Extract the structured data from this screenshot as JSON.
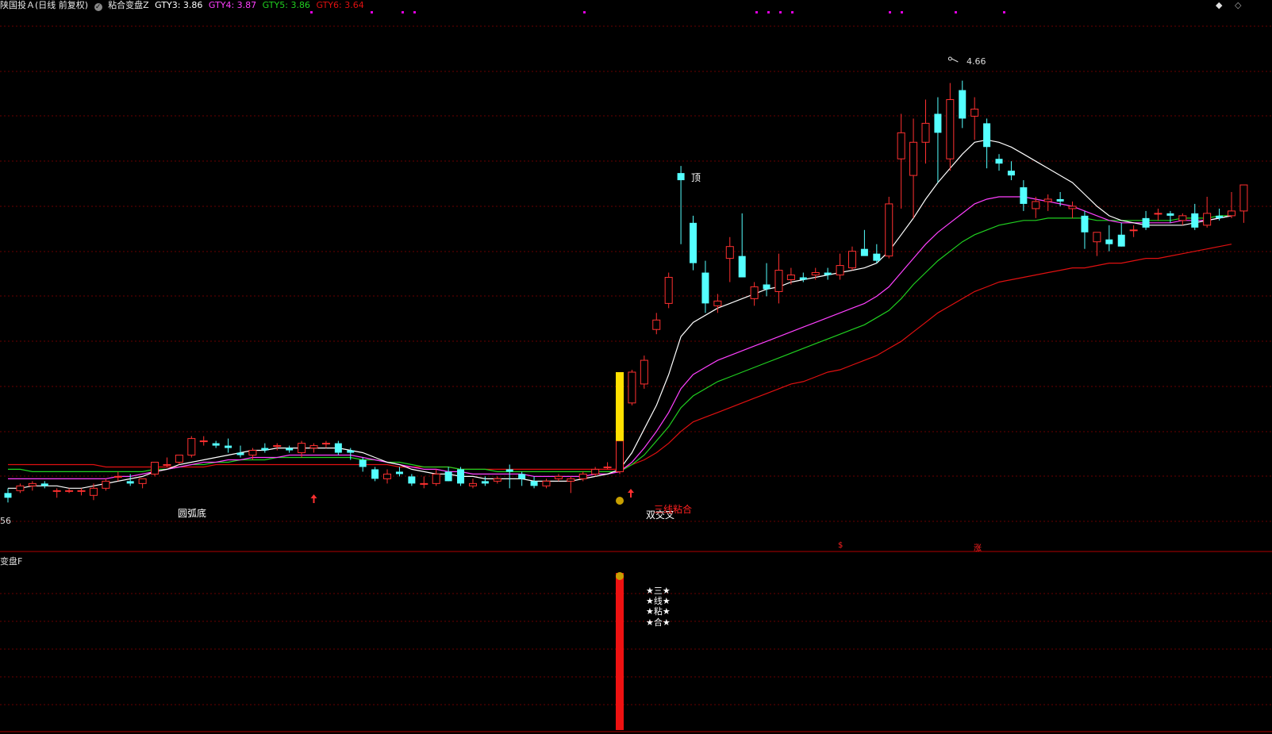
{
  "header": {
    "stock": "陕国投Ａ(日线 前复权)",
    "indicator": "粘合变盘Z",
    "gty3_label": "GTY3: 3.86",
    "gty4_label": "GTY4: 3.87",
    "gty5_label": "GTY5: 3.86",
    "gty6_label": "GTY6: 3.64"
  },
  "colors": {
    "up": "#ff3030",
    "down": "#54ffff",
    "gty3": "#ffffff",
    "gty4": "#ff40ff",
    "gty5": "#20d020",
    "gty6": "#e01010",
    "grid": "#6a0000",
    "signal_bar": "#ffe000",
    "sub_bar": "#ee1111"
  },
  "price_panel": {
    "high_label": "4.66",
    "low_label": "56",
    "annotations": {
      "top": "顶",
      "arc_bottom": "圆弧底",
      "double_cross": "双交叉",
      "three_line": "三线粘合"
    },
    "bottom_markers": [
      "$",
      "涨"
    ]
  },
  "sub_panel": {
    "title": "变盘F",
    "stars": [
      "★三★",
      "★线★",
      "★粘★",
      "★合★"
    ]
  },
  "top_icons": [
    "◆",
    "◇"
  ],
  "chart_data": {
    "type": "candlestick",
    "ylim": [
      2.7,
      4.95
    ],
    "candles": [
      [
        2.93,
        2.95,
        2.89,
        2.91
      ],
      [
        2.94,
        2.97,
        2.93,
        2.96
      ],
      [
        2.96,
        2.98,
        2.94,
        2.97
      ],
      [
        2.97,
        2.98,
        2.95,
        2.96
      ],
      [
        2.94,
        2.95,
        2.91,
        2.94
      ],
      [
        2.94,
        2.95,
        2.93,
        2.94
      ],
      [
        2.94,
        2.95,
        2.92,
        2.94
      ],
      [
        2.92,
        2.97,
        2.9,
        2.95
      ],
      [
        2.95,
        2.99,
        2.94,
        2.98
      ],
      [
        3.0,
        3.02,
        2.98,
        3.0
      ],
      [
        2.98,
        3.01,
        2.96,
        2.97
      ],
      [
        2.97,
        2.99,
        2.95,
        2.99
      ],
      [
        3.01,
        3.06,
        3.0,
        3.06
      ],
      [
        3.05,
        3.08,
        3.04,
        3.05
      ],
      [
        3.06,
        3.09,
        3.05,
        3.09
      ],
      [
        3.09,
        3.17,
        3.08,
        3.16
      ],
      [
        3.15,
        3.17,
        3.13,
        3.15
      ],
      [
        3.14,
        3.15,
        3.12,
        3.13
      ],
      [
        3.13,
        3.16,
        3.1,
        3.12
      ],
      [
        3.1,
        3.13,
        3.08,
        3.09
      ],
      [
        3.09,
        3.12,
        3.07,
        3.11
      ],
      [
        3.12,
        3.14,
        3.1,
        3.11
      ],
      [
        3.13,
        3.14,
        3.11,
        3.13
      ],
      [
        3.12,
        3.13,
        3.1,
        3.11
      ],
      [
        3.1,
        3.15,
        3.08,
        3.14
      ],
      [
        3.12,
        3.14,
        3.1,
        3.13
      ],
      [
        3.14,
        3.15,
        3.12,
        3.14
      ],
      [
        3.14,
        3.15,
        3.09,
        3.1
      ],
      [
        3.11,
        3.12,
        3.07,
        3.1
      ],
      [
        3.07,
        3.08,
        3.02,
        3.04
      ],
      [
        3.03,
        3.04,
        2.98,
        2.99
      ],
      [
        2.99,
        3.03,
        2.97,
        3.01
      ],
      [
        3.02,
        3.04,
        3.0,
        3.01
      ],
      [
        3.0,
        3.01,
        2.96,
        2.97
      ],
      [
        2.97,
        3.0,
        2.95,
        2.97
      ],
      [
        2.97,
        3.03,
        2.96,
        3.01
      ],
      [
        3.02,
        3.04,
        2.98,
        2.98
      ],
      [
        3.03,
        3.04,
        2.96,
        2.97
      ],
      [
        2.96,
        2.99,
        2.95,
        2.97
      ],
      [
        2.98,
        3.0,
        2.96,
        2.97
      ],
      [
        2.98,
        3.0,
        2.97,
        2.99
      ],
      [
        3.03,
        3.05,
        2.95,
        3.02
      ],
      [
        3.01,
        3.02,
        2.96,
        2.99
      ],
      [
        2.98,
        3.0,
        2.95,
        2.96
      ],
      [
        2.96,
        2.99,
        2.95,
        2.98
      ],
      [
        2.99,
        3.01,
        2.98,
        3.0
      ],
      [
        2.98,
        3.0,
        2.93,
        2.99
      ],
      [
        2.99,
        3.02,
        2.98,
        3.01
      ],
      [
        3.01,
        3.04,
        3.0,
        3.03
      ],
      [
        3.04,
        3.06,
        3.03,
        3.04
      ],
      [
        3.02,
        3.16,
        3.01,
        3.15
      ],
      [
        3.31,
        3.45,
        3.3,
        3.44
      ],
      [
        3.39,
        3.51,
        3.37,
        3.49
      ],
      [
        3.62,
        3.69,
        3.6,
        3.66
      ],
      [
        3.73,
        3.86,
        3.71,
        3.84
      ],
      [
        4.28,
        4.31,
        3.98,
        4.25
      ],
      [
        4.07,
        4.1,
        3.87,
        3.9
      ],
      [
        3.86,
        3.91,
        3.69,
        3.73
      ],
      [
        3.72,
        3.77,
        3.69,
        3.74
      ],
      [
        3.92,
        4.01,
        3.82,
        3.97
      ],
      [
        3.93,
        4.11,
        3.85,
        3.84
      ],
      [
        3.75,
        3.82,
        3.72,
        3.8
      ],
      [
        3.81,
        3.9,
        3.76,
        3.79
      ],
      [
        3.78,
        3.94,
        3.73,
        3.87
      ],
      [
        3.83,
        3.88,
        3.81,
        3.85
      ],
      [
        3.84,
        3.86,
        3.82,
        3.83
      ],
      [
        3.85,
        3.88,
        3.83,
        3.86
      ],
      [
        3.86,
        3.88,
        3.83,
        3.85
      ],
      [
        3.85,
        3.94,
        3.83,
        3.89
      ],
      [
        3.88,
        3.97,
        3.87,
        3.95
      ],
      [
        3.96,
        4.04,
        3.96,
        3.93
      ],
      [
        3.94,
        3.98,
        3.9,
        3.91
      ],
      [
        3.93,
        4.18,
        3.92,
        4.15
      ],
      [
        4.34,
        4.53,
        4.13,
        4.45
      ],
      [
        4.27,
        4.51,
        4.09,
        4.41
      ],
      [
        4.41,
        4.59,
        4.32,
        4.49
      ],
      [
        4.53,
        4.6,
        4.24,
        4.45
      ],
      [
        4.34,
        4.66,
        4.29,
        4.59
      ],
      [
        4.63,
        4.67,
        4.47,
        4.51
      ],
      [
        4.52,
        4.6,
        4.42,
        4.55
      ],
      [
        4.49,
        4.51,
        4.3,
        4.39
      ],
      [
        4.34,
        4.36,
        4.29,
        4.32
      ],
      [
        4.29,
        4.33,
        4.25,
        4.27
      ],
      [
        4.22,
        4.25,
        4.12,
        4.15
      ],
      [
        4.13,
        4.18,
        4.09,
        4.16
      ],
      [
        4.16,
        4.19,
        4.12,
        4.17
      ],
      [
        4.17,
        4.2,
        4.14,
        4.16
      ],
      [
        4.13,
        4.16,
        4.09,
        4.14
      ],
      [
        4.1,
        4.12,
        3.96,
        4.03
      ],
      [
        3.99,
        4.01,
        3.93,
        4.03
      ],
      [
        4.0,
        4.06,
        3.95,
        3.98
      ],
      [
        4.02,
        4.07,
        3.97,
        3.97
      ],
      [
        4.04,
        4.06,
        4.01,
        4.04
      ],
      [
        4.09,
        4.12,
        4.04,
        4.05
      ],
      [
        4.11,
        4.13,
        4.08,
        4.11
      ],
      [
        4.11,
        4.12,
        4.07,
        4.1
      ],
      [
        4.08,
        4.11,
        4.06,
        4.1
      ],
      [
        4.11,
        4.15,
        4.04,
        4.05
      ],
      [
        4.06,
        4.18,
        4.05,
        4.11
      ],
      [
        4.1,
        4.13,
        4.08,
        4.09
      ],
      [
        4.1,
        4.2,
        4.09,
        4.12
      ],
      [
        4.12,
        4.15,
        4.07,
        4.23
      ]
    ],
    "lines": {
      "gty3": [
        2.95,
        2.95,
        2.96,
        2.96,
        2.96,
        2.95,
        2.95,
        2.96,
        2.97,
        2.98,
        2.99,
        3.0,
        3.02,
        3.03,
        3.05,
        3.06,
        3.07,
        3.08,
        3.09,
        3.1,
        3.11,
        3.11,
        3.12,
        3.12,
        3.12,
        3.12,
        3.12,
        3.12,
        3.11,
        3.1,
        3.08,
        3.06,
        3.05,
        3.03,
        3.02,
        3.01,
        3.01,
        3.0,
        3.0,
        2.99,
        2.99,
        2.99,
        2.99,
        2.98,
        2.98,
        2.98,
        2.98,
        2.99,
        3.0,
        3.01,
        3.03,
        3.1,
        3.2,
        3.3,
        3.43,
        3.59,
        3.65,
        3.68,
        3.71,
        3.73,
        3.75,
        3.77,
        3.79,
        3.8,
        3.82,
        3.83,
        3.84,
        3.85,
        3.86,
        3.87,
        3.88,
        3.9,
        3.95,
        4.02,
        4.09,
        4.17,
        4.24,
        4.3,
        4.36,
        4.41,
        4.42,
        4.41,
        4.39,
        4.36,
        4.33,
        4.3,
        4.27,
        4.24,
        4.19,
        4.14,
        4.1,
        4.08,
        4.07,
        4.06,
        4.06,
        4.06,
        4.06,
        4.07,
        4.08,
        4.09,
        4.1
      ],
      "gty4": [
        2.99,
        2.99,
        2.99,
        2.99,
        2.99,
        2.99,
        2.99,
        2.99,
        2.99,
        3.0,
        3.0,
        3.01,
        3.02,
        3.03,
        3.04,
        3.05,
        3.06,
        3.06,
        3.07,
        3.07,
        3.08,
        3.08,
        3.08,
        3.09,
        3.09,
        3.09,
        3.09,
        3.09,
        3.09,
        3.08,
        3.07,
        3.06,
        3.05,
        3.04,
        3.03,
        3.03,
        3.02,
        3.02,
        3.01,
        3.01,
        3.01,
        3.01,
        3.01,
        3.0,
        3.0,
        3.0,
        3.0,
        3.0,
        3.01,
        3.01,
        3.02,
        3.06,
        3.12,
        3.19,
        3.27,
        3.37,
        3.43,
        3.46,
        3.49,
        3.51,
        3.53,
        3.55,
        3.57,
        3.59,
        3.61,
        3.63,
        3.65,
        3.67,
        3.69,
        3.71,
        3.73,
        3.76,
        3.8,
        3.86,
        3.92,
        3.98,
        4.03,
        4.07,
        4.11,
        4.15,
        4.17,
        4.18,
        4.18,
        4.18,
        4.17,
        4.16,
        4.15,
        4.14,
        4.12,
        4.1,
        4.08,
        4.07,
        4.07,
        4.07,
        4.07,
        4.07,
        4.08,
        4.08,
        4.08,
        4.09,
        4.1
      ],
      "gty5": [
        3.03,
        3.03,
        3.02,
        3.02,
        3.02,
        3.02,
        3.02,
        3.02,
        3.02,
        3.02,
        3.02,
        3.02,
        3.03,
        3.03,
        3.04,
        3.05,
        3.05,
        3.06,
        3.06,
        3.07,
        3.07,
        3.07,
        3.08,
        3.08,
        3.08,
        3.08,
        3.08,
        3.08,
        3.08,
        3.07,
        3.07,
        3.06,
        3.06,
        3.05,
        3.04,
        3.04,
        3.04,
        3.03,
        3.03,
        3.03,
        3.02,
        3.02,
        3.02,
        3.02,
        3.02,
        3.02,
        3.02,
        3.02,
        3.02,
        3.02,
        3.02,
        3.05,
        3.09,
        3.15,
        3.21,
        3.29,
        3.34,
        3.37,
        3.4,
        3.42,
        3.44,
        3.46,
        3.48,
        3.5,
        3.52,
        3.54,
        3.56,
        3.58,
        3.6,
        3.62,
        3.64,
        3.67,
        3.7,
        3.75,
        3.81,
        3.86,
        3.91,
        3.95,
        3.99,
        4.02,
        4.04,
        4.06,
        4.07,
        4.08,
        4.08,
        4.09,
        4.09,
        4.09,
        4.09,
        4.08,
        4.08,
        4.08,
        4.08,
        4.08,
        4.08,
        4.08,
        4.09,
        4.09,
        4.09,
        4.1,
        4.1
      ],
      "gty6": [
        3.05,
        3.05,
        3.05,
        3.05,
        3.05,
        3.05,
        3.05,
        3.05,
        3.04,
        3.04,
        3.04,
        3.04,
        3.04,
        3.04,
        3.04,
        3.04,
        3.04,
        3.05,
        3.05,
        3.05,
        3.05,
        3.05,
        3.05,
        3.05,
        3.05,
        3.05,
        3.05,
        3.05,
        3.05,
        3.05,
        3.05,
        3.05,
        3.04,
        3.04,
        3.04,
        3.04,
        3.04,
        3.03,
        3.03,
        3.03,
        3.03,
        3.03,
        3.03,
        3.03,
        3.03,
        3.03,
        3.03,
        3.03,
        3.03,
        3.03,
        3.03,
        3.05,
        3.07,
        3.1,
        3.14,
        3.19,
        3.23,
        3.25,
        3.27,
        3.29,
        3.31,
        3.33,
        3.35,
        3.37,
        3.39,
        3.4,
        3.42,
        3.44,
        3.45,
        3.47,
        3.49,
        3.51,
        3.54,
        3.57,
        3.61,
        3.65,
        3.69,
        3.72,
        3.75,
        3.78,
        3.8,
        3.82,
        3.83,
        3.84,
        3.85,
        3.86,
        3.87,
        3.88,
        3.88,
        3.89,
        3.9,
        3.9,
        3.91,
        3.92,
        3.92,
        3.93,
        3.94,
        3.95,
        3.96,
        3.97,
        3.98
      ]
    },
    "signal_candle_index": 50
  }
}
